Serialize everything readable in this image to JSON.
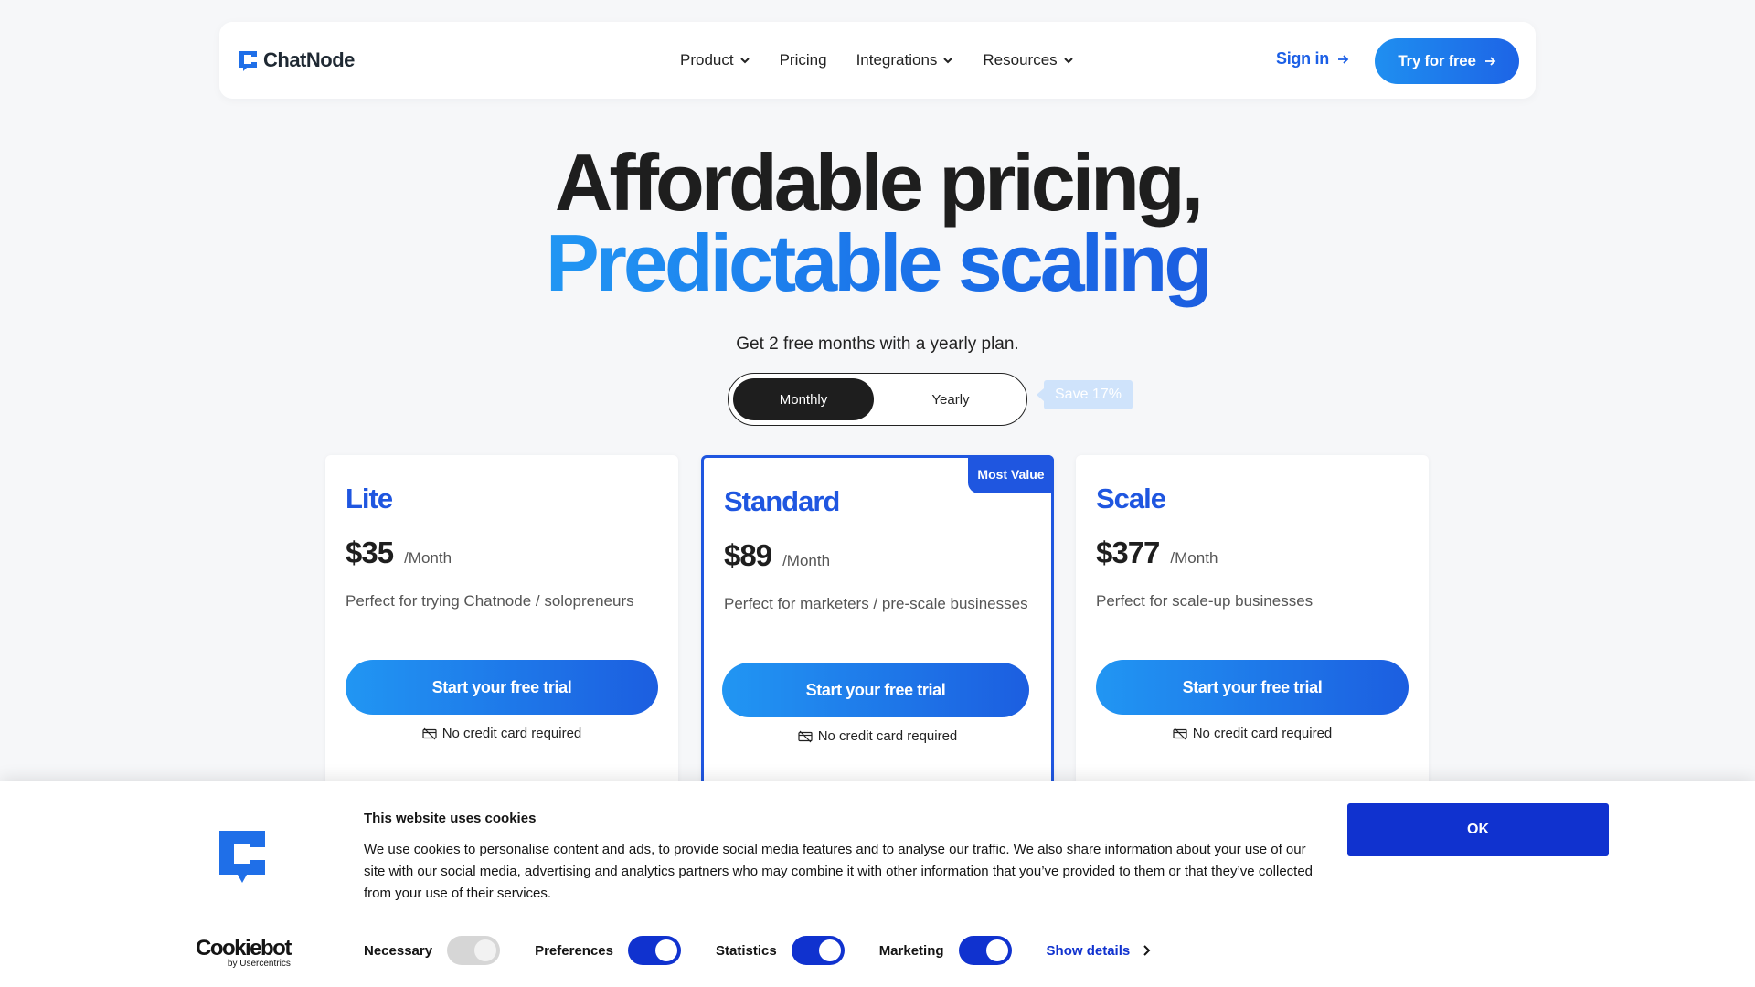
{
  "header": {
    "brand": "ChatNode",
    "nav": [
      {
        "label": "Product",
        "has_dropdown": true
      },
      {
        "label": "Pricing",
        "has_dropdown": false
      },
      {
        "label": "Integrations",
        "has_dropdown": true
      },
      {
        "label": "Resources",
        "has_dropdown": true
      }
    ],
    "signin_label": "Sign in",
    "cta_label": "Try for free"
  },
  "hero": {
    "line1": "Affordable pricing,",
    "line2": "Predictable scaling",
    "subtitle": "Get 2 free months with a yearly plan."
  },
  "billing_toggle": {
    "options": [
      "Monthly",
      "Yearly"
    ],
    "selected": "Monthly",
    "save_badge": "Save 17%"
  },
  "plans": [
    {
      "name": "Lite",
      "price": "$35",
      "period": "/Month",
      "description": "Perfect for trying Chatnode / solopreneurs",
      "cta": "Start your free trial",
      "note": "No credit card required"
    },
    {
      "name": "Standard",
      "price": "$89",
      "period": "/Month",
      "description": "Perfect for marketers / pre-scale businesses",
      "cta": "Start your free trial",
      "note": "No credit card required",
      "badge": "Most Value"
    },
    {
      "name": "Scale",
      "price": "$377",
      "period": "/Month",
      "description": "Perfect for scale-up businesses",
      "cta": "Start your free trial",
      "note": "No credit card required"
    }
  ],
  "cookie_banner": {
    "title": "This website uses cookies",
    "text": "We use cookies to personalise content and ads, to provide social media features and to analyse our traffic. We also share information about your use of our site with our social media, advertising and analytics partners who may combine it with other information that you’ve provided to them or that they’ve collected from your use of their services.",
    "consents": [
      {
        "label": "Necessary",
        "on": true,
        "locked": true
      },
      {
        "label": "Preferences",
        "on": true
      },
      {
        "label": "Statistics",
        "on": true
      },
      {
        "label": "Marketing",
        "on": true
      }
    ],
    "show_details": "Show details",
    "ok": "OK",
    "provider": "Cookiebot",
    "provider_sub": "by Usercentrics"
  },
  "colors": {
    "accent": "#1f56e0",
    "gradient_start": "#2196f3",
    "gradient_end": "#1c5ee0",
    "cookie_accent": "#1032cf",
    "page_bg": "#f6f7f9"
  }
}
